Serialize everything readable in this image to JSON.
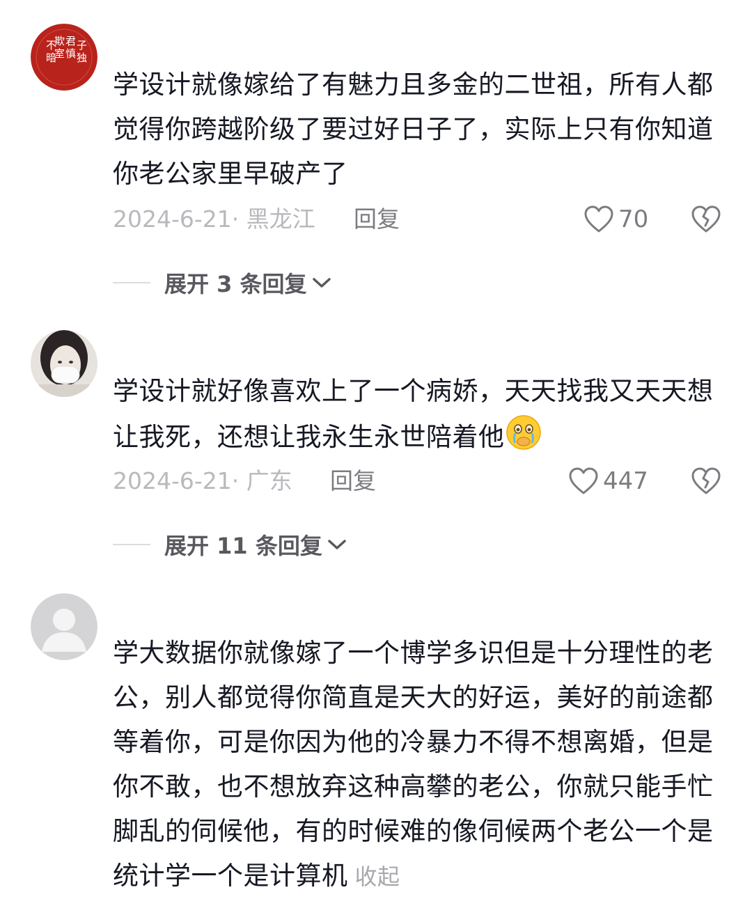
{
  "comments": [
    {
      "text": "学设计就像嫁给了有魅力且多金的二世祖，所有人都觉得你跨越阶级了要过好日子了，实际上只有你知道你老公家里早破产了",
      "date_location": "2024-6-21· 黑龙江",
      "reply_label": "回复",
      "likes": "70",
      "expand_label": "展开 3 条回复",
      "avatar_icon": "seal-logo",
      "avatar_seal_text": "君子慎独 不欺暗室"
    },
    {
      "text": "学设计就好像喜欢上了一个病娇，天天找我又天天想让我死，还想让我永生永世陪着他",
      "emoji": "crying-face-emoji",
      "date_location": "2024-6-21· 广东",
      "reply_label": "回复",
      "likes": "447",
      "expand_label": "展开 11 条回复",
      "avatar_icon": "user-photo-avatar"
    },
    {
      "text": "学大数据你就像嫁了一个博学多识但是十分理性的老公，别人都觉得你简直是天大的好运，美好的前途都等着你，可是你因为他的冷暴力不得不想离婚，但是你不敢，也不想放弃这种高攀的老公，你就只能手忙脚乱的伺候他，有的时候难的像伺候两个老公一个是统计学一个是计算机",
      "collapse_label": "收起",
      "avatar_icon": "default-avatar-icon"
    }
  ],
  "colors": {
    "text_primary": "#161823",
    "text_meta": "#b9b9bd",
    "text_secondary": "#7b7b80",
    "seal_red": "#b8231c"
  }
}
